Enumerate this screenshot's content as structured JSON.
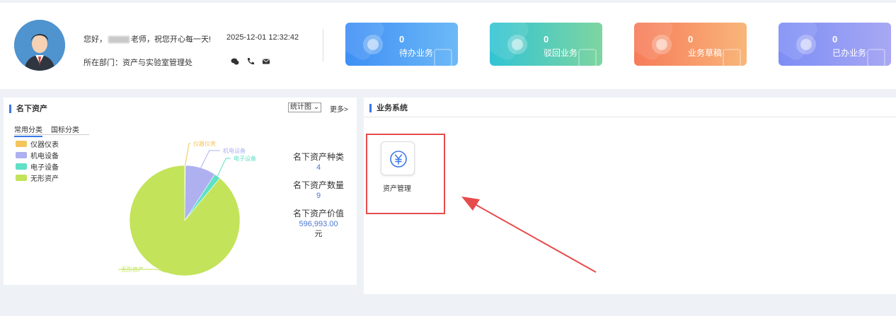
{
  "header": {
    "greeting_prefix": "您好，",
    "greeting_suffix": "老师，祝您开心每一天!",
    "department_label": "所在部门：资产与实验室管理处",
    "datetime": "2025-12-01 12:32:42",
    "contact_icons": [
      "wechat-icon",
      "phone-icon",
      "mail-icon"
    ]
  },
  "cards": [
    {
      "count": "0",
      "label": "待办业务",
      "icon": "todo-doc-icon"
    },
    {
      "count": "0",
      "label": "驳回业务",
      "icon": "rejected-user-icon"
    },
    {
      "count": "0",
      "label": "业务草稿",
      "icon": "draft-icon"
    },
    {
      "count": "0",
      "label": "已办业务",
      "icon": "done-icon"
    }
  ],
  "assets_panel": {
    "title": "名下资产",
    "select_value": "统计图",
    "more_label": "更多>",
    "tabs": [
      "常用分类",
      "国标分类"
    ],
    "stats": [
      {
        "label": "名下资产种类",
        "value": "4",
        "unit": ""
      },
      {
        "label": "名下资产数量",
        "value": "9",
        "unit": ""
      },
      {
        "label": "名下资产价值",
        "value": "596,993.00",
        "unit": "元"
      }
    ]
  },
  "chart_data": {
    "type": "pie",
    "title": "",
    "categories": [
      "仪器仪表",
      "机电设备",
      "电子设备",
      "无形资产"
    ],
    "values": [
      0.2,
      9.0,
      1.8,
      89.0
    ],
    "colors": [
      "#f4c55c",
      "#aeb0f0",
      "#5fe0c7",
      "#c3e35a"
    ],
    "legend": "top-left",
    "slice_labels": [
      "仪器仪表",
      "机电设备",
      "电子设备",
      "无形资产"
    ]
  },
  "business_panel": {
    "title": "业务系统",
    "systems": [
      {
        "label": "资产管理",
        "icon": "yuan-circle-icon"
      }
    ]
  },
  "colors": {
    "accent": "#3a78e8",
    "highlight": "#e74c4c"
  }
}
